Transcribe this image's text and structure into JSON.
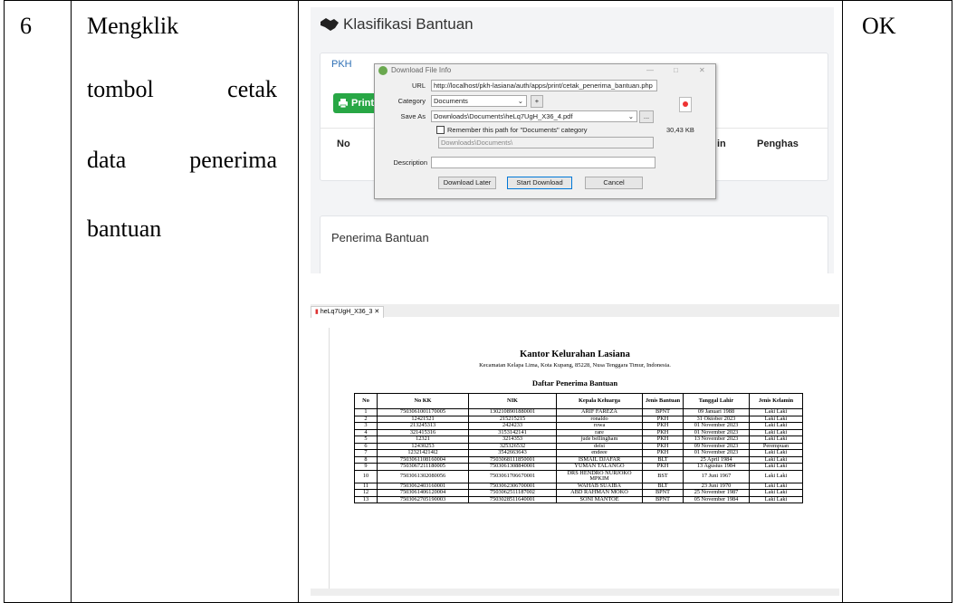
{
  "row": {
    "number": "6",
    "description_lines": [
      [
        "Mengklik"
      ],
      [
        "tombol",
        "cetak"
      ],
      [
        "data",
        "penerima"
      ],
      [
        "bantuan"
      ]
    ],
    "result": "OK"
  },
  "screenshot1": {
    "page_title": "Klasifikasi Bantuan",
    "tab_label": "PKH",
    "print_button": "Print",
    "col_no": "No",
    "col_cut1": "in",
    "col_cut2": "Penghas",
    "section_title": "Penerima Bantuan",
    "dialog": {
      "title": "Download File Info",
      "url_label": "URL",
      "url_value": "http://localhost/pkh-lasiana/auth/apps/print/cetak_penerima_bantuan.php",
      "category_label": "Category",
      "category_value": "Documents",
      "add_button": "+",
      "saveas_label": "Save As",
      "saveas_value": "Downloads\\Documents\\heLq7UgH_X36_4.pdf",
      "browse_button": "...",
      "remember_label": "Remember this path for \"Documents\" category",
      "path_value": "Downloads\\Documents\\",
      "file_size": "30,43 KB",
      "description_label": "Description",
      "description_value": "",
      "download_later": "Download Later",
      "start_download": "Start Download",
      "cancel": "Cancel"
    }
  },
  "screenshot2": {
    "tab_name": "heLq7UgH_X36_3",
    "office": "Kantor Kelurahan Lasiana",
    "address": "Kecamatan Kelapa Lima, Kota Kupang, 85228, Nusa Tenggara Timur, Indonesia.",
    "list_title": "Daftar Penerima Bantuan",
    "columns": [
      "No",
      "No KK",
      "NIK",
      "Kepala Keluarga",
      "Jenis Bantuan",
      "Tanggal Lahir",
      "Jenis Kelamin"
    ],
    "rows": [
      [
        "1",
        "7503061001170005",
        "1302108901880001",
        "ARIF FAREZA",
        "BPNT",
        "09 Januari 1988",
        "Laki Laki"
      ],
      [
        "2",
        "12421521",
        "215215215",
        "ronaldo",
        "PKH",
        "31 Oktober 2023",
        "Laki Laki"
      ],
      [
        "3",
        "213245313",
        "2424233",
        "rowa",
        "PKH",
        "01 November 2023",
        "Laki Laki"
      ],
      [
        "4",
        "321415316",
        "3153142141",
        "rare",
        "PKH",
        "01 November 2023",
        "Laki Laki"
      ],
      [
        "5",
        "12321",
        "3214353",
        "jude bellingham",
        "PKH",
        "13 November 2023",
        "Laki Laki"
      ],
      [
        "6",
        "12430253",
        "325326532",
        "delsi",
        "PKH",
        "09 November 2023",
        "Perempuan"
      ],
      [
        "7",
        "123214214l2",
        "3542663643",
        "endeee",
        "PKH",
        "01 November 2023",
        "Laki Laki"
      ],
      [
        "8",
        "7503061108160004",
        "7503068111850001",
        "ISMAIL DJAFAR",
        "BLT",
        "25 April 1984",
        "Laki Laki"
      ],
      [
        "9",
        "7503067211180005",
        "7503061308840001",
        "YUMAN TALANGO",
        "PKH",
        "13 Agustus 1984",
        "Laki Laki"
      ],
      [
        "10",
        "7503061302080056",
        "7503061706670001",
        "DRS HENDRO NURJOKO MPKIM",
        "BST",
        "17 Juni 1967",
        "Laki Laki"
      ],
      [
        "11",
        "7503062403160001",
        "7503062306700001",
        "WAHAB SUAIBA",
        "BLT",
        "23 Juni 1970",
        "Laki Laki"
      ],
      [
        "12",
        "7503061406120004",
        "7503062511187002",
        "ABD RAHMAN MOKO",
        "BPNT",
        "25 November 1987",
        "Laki Laki"
      ],
      [
        "13",
        "7503062705190003",
        "7503028511640001",
        "SONI MANTOE",
        "BPNT",
        "05 November 1984",
        "Laki Laki"
      ]
    ]
  },
  "colors": {
    "print_green": "#28a745",
    "link_blue": "#2d6fb5"
  }
}
